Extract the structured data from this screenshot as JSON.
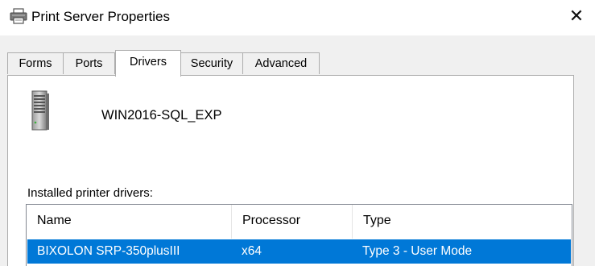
{
  "window": {
    "title": "Print Server Properties",
    "close_glyph": "✕",
    "icon": "printer-icon"
  },
  "tabs": [
    {
      "label": "Forms",
      "selected": false
    },
    {
      "label": "Ports",
      "selected": false
    },
    {
      "label": "Drivers",
      "selected": true
    },
    {
      "label": "Security",
      "selected": false
    },
    {
      "label": "Advanced",
      "selected": false
    }
  ],
  "server": {
    "icon": "server-tower-icon",
    "name": "WIN2016-SQL_EXP"
  },
  "drivers": {
    "label": "Installed printer drivers:",
    "columns": [
      "Name",
      "Processor",
      "Type"
    ],
    "rows": [
      {
        "name": "BIXOLON SRP-350plusIII",
        "processor": "x64",
        "type": "Type 3 - User Mode",
        "selected": true
      }
    ]
  },
  "colors": {
    "selection": "#0078d7",
    "dialog_background": "#f0f0f0"
  }
}
